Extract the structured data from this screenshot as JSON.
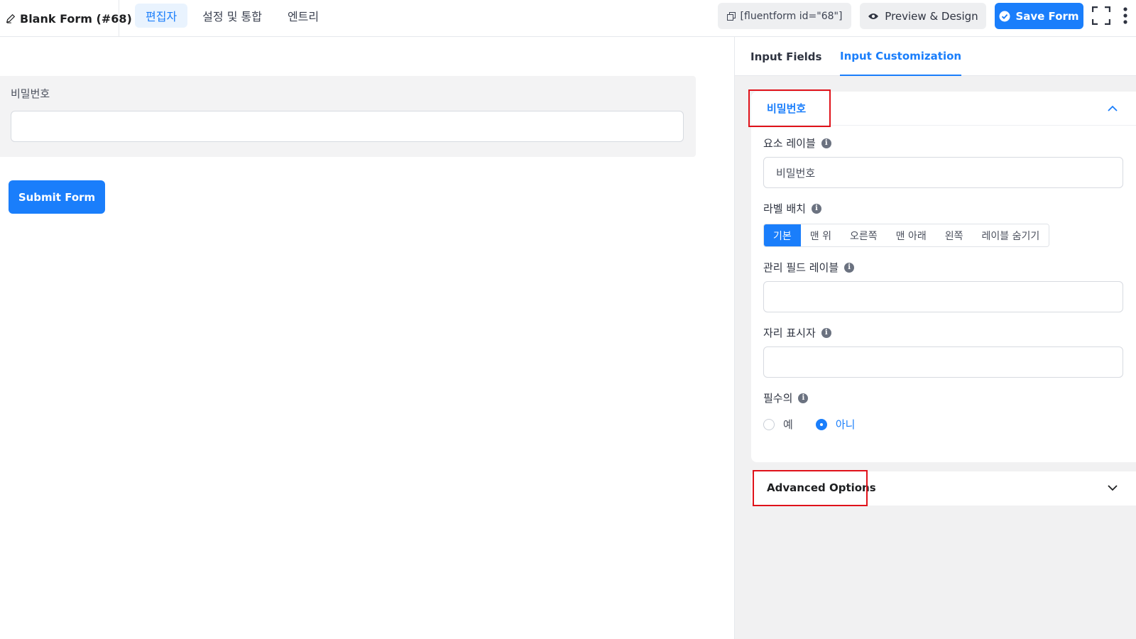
{
  "header": {
    "form_title": "Blank Form (#68)",
    "tabs": [
      {
        "label": "편집자",
        "active": true
      },
      {
        "label": "설정 및 통합",
        "active": false
      },
      {
        "label": "엔트리",
        "active": false
      }
    ],
    "shortcode": "[fluentform id=\"68\"]",
    "preview_label": "Preview & Design",
    "save_label": "Save Form",
    "icons": [
      "pen-icon",
      "copy-icon",
      "eye-icon",
      "check-circle-icon",
      "fullscreen-icon",
      "more-vertical-icon"
    ]
  },
  "editor": {
    "field_label": "비밀번호",
    "field_value": "",
    "submit_label": "Submit Form"
  },
  "panel": {
    "tabs": [
      {
        "label": "Input Fields",
        "active": false
      },
      {
        "label": "Input Customization",
        "active": true
      }
    ],
    "section_title": "비밀번호",
    "element_label": {
      "label": "요소 레이블",
      "value": "비밀번호"
    },
    "label_placement": {
      "label": "라벨 배치",
      "options": [
        "기본",
        "맨 위",
        "오른쪽",
        "맨 아래",
        "왼쪽",
        "레이블 숨기기"
      ],
      "selected": "기본"
    },
    "admin_field_label": {
      "label": "관리 필드 레이블",
      "value": ""
    },
    "placeholder": {
      "label": "자리 표시자",
      "value": ""
    },
    "required": {
      "label": "필수의",
      "options": [
        "예",
        "아니"
      ],
      "selected": "아니"
    },
    "advanced_title": "Advanced Options"
  },
  "colors": {
    "accent": "#1a7efb",
    "highlight_box": "#e0121a",
    "panel_bg": "#f1f1f2"
  }
}
